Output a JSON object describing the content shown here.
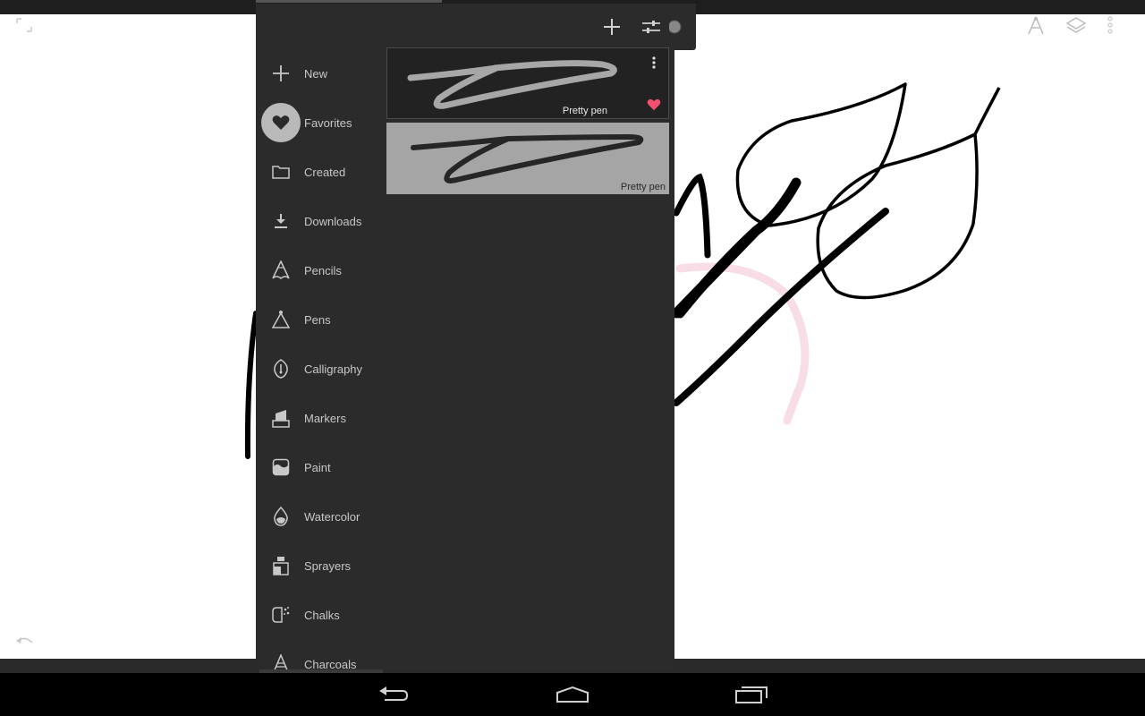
{
  "panel": {
    "header": {
      "add_icon": "plus-icon",
      "settings_icon": "sliders-icon"
    },
    "categories": [
      {
        "label": "New",
        "icon": "plus-icon",
        "selected": false
      },
      {
        "label": "Favorites",
        "icon": "heart-icon",
        "selected": true
      },
      {
        "label": "Created",
        "icon": "folder-icon",
        "selected": false
      },
      {
        "label": "Downloads",
        "icon": "download-icon",
        "selected": false
      },
      {
        "label": "Pencils",
        "icon": "pencil-icon",
        "selected": false
      },
      {
        "label": "Pens",
        "icon": "pen-nib-icon",
        "selected": false
      },
      {
        "label": "Calligraphy",
        "icon": "calligraphy-nib-icon",
        "selected": false
      },
      {
        "label": "Markers",
        "icon": "marker-icon",
        "selected": false
      },
      {
        "label": "Paint",
        "icon": "paint-icon",
        "selected": false
      },
      {
        "label": "Watercolor",
        "icon": "water-drop-icon",
        "selected": false
      },
      {
        "label": "Sprayers",
        "icon": "spray-can-icon",
        "selected": false
      },
      {
        "label": "Chalks",
        "icon": "chalk-icon",
        "selected": false
      },
      {
        "label": "Charcoals",
        "icon": "charcoal-icon",
        "selected": false
      }
    ],
    "brushes": [
      {
        "name": "Pretty pen",
        "favorite": true,
        "style": "dark"
      },
      {
        "name": "Pretty pen",
        "favorite": false,
        "style": "light"
      }
    ]
  },
  "toolbar": {
    "brush_tool_icon": "brush-tool-icon",
    "layers_icon": "layers-icon",
    "more_icon": "more-vertical-icon",
    "fullscreen_icon": "fullscreen-icon",
    "undo_icon": "undo-icon"
  },
  "navigation": {
    "back_icon": "back-icon",
    "home_icon": "home-icon",
    "recents_icon": "recents-icon"
  },
  "colors": {
    "panel_bg": "#2b2b2c",
    "selected_circle": "#b9b9b9",
    "favorite_heart": "#f2506e",
    "canvas_bg": "#ffffff"
  }
}
